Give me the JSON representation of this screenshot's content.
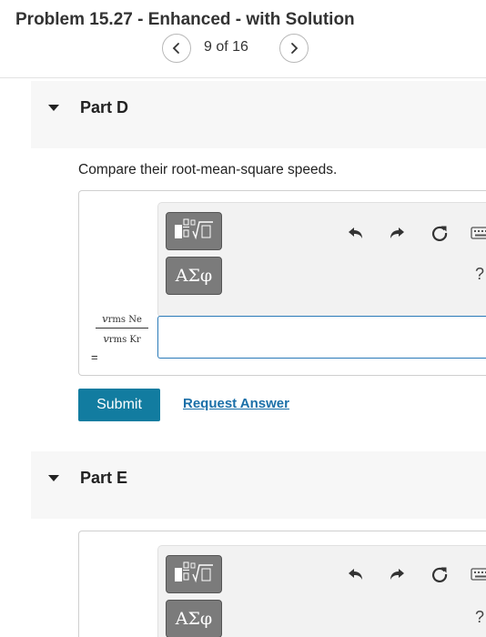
{
  "header": {
    "title": "Problem 15.27 - Enhanced - with Solution",
    "pager": "9 of 16"
  },
  "part_d": {
    "title": "Part D",
    "question": "Compare their root-mean-square speeds.",
    "toolbar": {
      "greek_label": "ΑΣφ",
      "help_label": "?"
    },
    "fraction": {
      "num_var": "v",
      "num_sub": "rms Ne",
      "den_var": "v",
      "den_sub": "rms Kr",
      "equals": "="
    },
    "answer_value": "",
    "submit_label": "Submit",
    "request_label": "Request Answer"
  },
  "part_e": {
    "title": "Part E",
    "toolbar": {
      "greek_label": "ΑΣφ",
      "help_label": "?"
    }
  },
  "icons": [
    "chevron-left-icon",
    "chevron-right-icon",
    "caret-down-icon",
    "templates-icon",
    "undo-icon",
    "redo-icon",
    "reset-icon",
    "keyboard-icon"
  ],
  "colors": {
    "submit_bg": "#127ca0",
    "link": "#1b6fa8",
    "input_border": "#2a7ab8",
    "toolbar_button": "#7b7b7b"
  }
}
